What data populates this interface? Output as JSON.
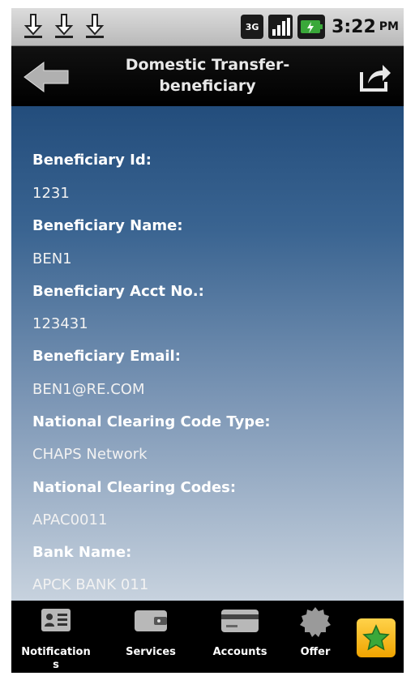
{
  "status_bar": {
    "network": "3G",
    "time": "3:22",
    "ampm": "PM"
  },
  "header": {
    "title_line1": "Domestic Transfer-",
    "title_line2": "beneficiary"
  },
  "details": [
    {
      "label": "Beneficiary Id:",
      "value": "1231"
    },
    {
      "label": "Beneficiary Name:",
      "value": "BEN1"
    },
    {
      "label": "Beneficiary Acct No.:",
      "value": "123431"
    },
    {
      "label": "Beneficiary Email:",
      "value": "BEN1@RE.COM"
    },
    {
      "label": "National Clearing Code Type:",
      "value": "CHAPS Network"
    },
    {
      "label": "National Clearing Codes:",
      "value": "APAC0011"
    },
    {
      "label": "Bank Name:",
      "value": "APCK BANK 011"
    }
  ],
  "bottom_nav": {
    "notifications": "Notification",
    "notifications_wrap": "s",
    "services": "Services",
    "accounts": "Accounts",
    "offers": "Offer"
  },
  "colors": {
    "content_top": "#234d7c",
    "content_bottom": "#c7d2de",
    "favorite": "#f0a400",
    "star": "#3aa83a"
  }
}
